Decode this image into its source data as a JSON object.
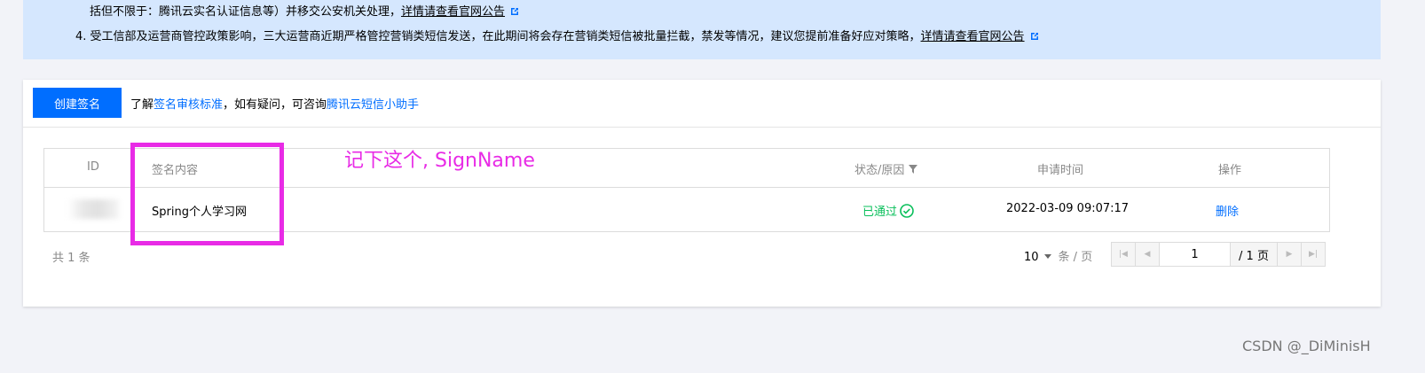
{
  "notice": {
    "line1_prefix": "括但不限于：腾讯云实名认证信息等）并移交公安机关处理，",
    "line1_link": "详情请查看官网公告",
    "line2_prefix": "4. 受工信部及运营商管控政策影响，三大运营商近期严格管控营销类短信发送，在此期间将会存在营销类短信被批量拦截，禁发等情况，建议您提前准备好应对策略，",
    "line2_link": "详情请查看官网公告"
  },
  "toolbar": {
    "create_label": "创建签名",
    "hint_prefix": "了解",
    "hint_link1": "签名审核标准",
    "hint_middle": "，如有疑问，可咨询",
    "hint_link2": "腾讯云短信小助手"
  },
  "table": {
    "headers": {
      "id": "ID",
      "content": "签名内容",
      "status": "状态/原因",
      "time": "申请时间",
      "action": "操作"
    },
    "rows": [
      {
        "content": "Spring个人学习网",
        "status": "已通过",
        "time": "2022-03-09 09:07:17",
        "action": "删除"
      }
    ]
  },
  "footer": {
    "total": "共 1 条",
    "page_size": "10",
    "per_page": "条 / 页",
    "current_page": "1",
    "total_pages": "/ 1 页"
  },
  "annotation": {
    "text": "记下这个, SignName",
    "color": "#e82be6"
  },
  "watermark": "CSDN @_DiMinisH",
  "colors": {
    "primary": "#006eff",
    "notice_bg": "#d5e7fe",
    "success": "#0abf5b"
  }
}
